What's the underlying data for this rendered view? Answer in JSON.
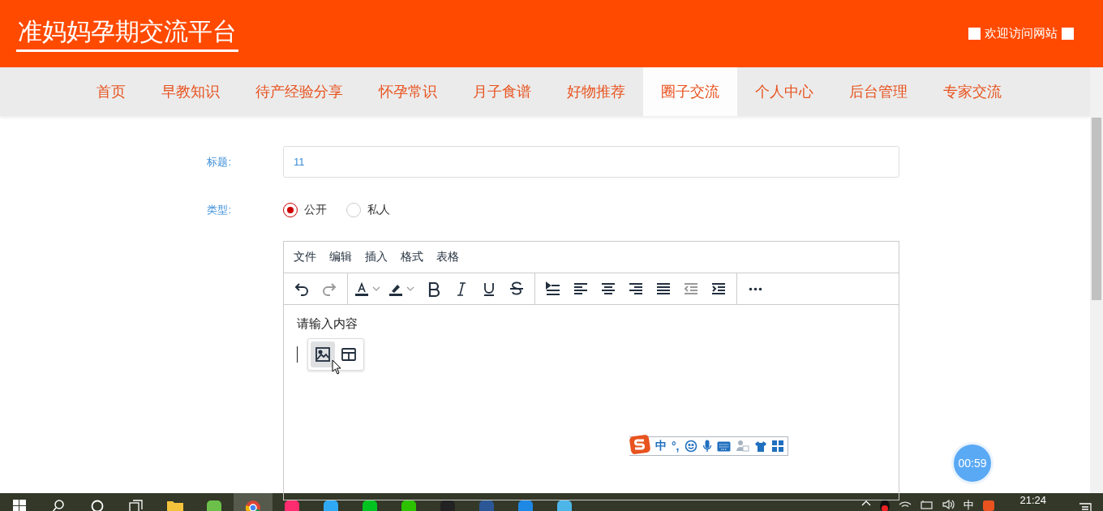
{
  "header": {
    "title": "准妈妈孕期交流平台",
    "welcome": "欢迎访问网站"
  },
  "nav": [
    {
      "label": "首页",
      "selected": false
    },
    {
      "label": "早教知识",
      "selected": false
    },
    {
      "label": "待产经验分享",
      "selected": false
    },
    {
      "label": "怀孕常识",
      "selected": false
    },
    {
      "label": "月子食谱",
      "selected": false
    },
    {
      "label": "好物推荐",
      "selected": false
    },
    {
      "label": "圈子交流",
      "selected": true
    },
    {
      "label": "个人中心",
      "selected": false
    },
    {
      "label": "后台管理",
      "selected": false
    },
    {
      "label": "专家交流",
      "selected": false
    }
  ],
  "form": {
    "title_label": "标题:",
    "title_value": "11",
    "type_label": "类型:",
    "type_options": [
      {
        "label": "公开",
        "selected": true
      },
      {
        "label": "私人",
        "selected": false
      }
    ]
  },
  "editor": {
    "menu": [
      "文件",
      "编辑",
      "插入",
      "格式",
      "表格"
    ],
    "toolbar": [
      [
        {
          "kind": "undo",
          "disabled": false
        },
        {
          "kind": "redo",
          "disabled": true
        }
      ],
      [
        {
          "kind": "forecolor",
          "disabled": false
        },
        {
          "kind": "highlight",
          "disabled": false
        },
        {
          "kind": "bold",
          "disabled": false
        },
        {
          "kind": "italic",
          "disabled": false
        },
        {
          "kind": "underline",
          "disabled": false
        },
        {
          "kind": "strike",
          "disabled": false
        }
      ],
      [
        {
          "kind": "lineheight",
          "disabled": false
        },
        {
          "kind": "alignleft",
          "disabled": false
        },
        {
          "kind": "aligncenter",
          "disabled": false
        },
        {
          "kind": "alignright",
          "disabled": false
        },
        {
          "kind": "justify",
          "disabled": false
        },
        {
          "kind": "outdent",
          "disabled": true
        },
        {
          "kind": "indent",
          "disabled": false
        }
      ],
      [
        {
          "kind": "more",
          "disabled": false
        }
      ]
    ],
    "placeholder": "请输入内容",
    "quick_insert": [
      {
        "kind": "image",
        "selected": true
      },
      {
        "kind": "table",
        "selected": false
      }
    ]
  },
  "ime_bar": {
    "mode": "中",
    "punctuation": "°,"
  },
  "timer": "00:59",
  "taskbar": {
    "apps": [
      {
        "kind": "start",
        "selected": false
      },
      {
        "kind": "search",
        "selected": false
      },
      {
        "kind": "cortana",
        "selected": false
      },
      {
        "kind": "taskview",
        "selected": false
      },
      {
        "kind": "folder",
        "selected": false
      },
      {
        "kind": "app",
        "color": "#6cc04a",
        "selected": false
      },
      {
        "kind": "browser",
        "selected": true
      },
      {
        "kind": "app",
        "color": "#ff2d6f",
        "selected": false
      },
      {
        "kind": "app",
        "color": "#2fa9f5",
        "selected": false
      },
      {
        "kind": "app",
        "color": "#00c322",
        "selected": false
      },
      {
        "kind": "app",
        "color": "#2dc100",
        "selected": false
      },
      {
        "kind": "app",
        "color": "#222222",
        "selected": false
      },
      {
        "kind": "app",
        "color": "#2b5797",
        "selected": false
      },
      {
        "kind": "app",
        "color": "#1e88e5",
        "selected": false
      },
      {
        "kind": "app",
        "color": "#4db6e8",
        "selected": false
      }
    ],
    "input_method": "中",
    "time": "21:24"
  }
}
